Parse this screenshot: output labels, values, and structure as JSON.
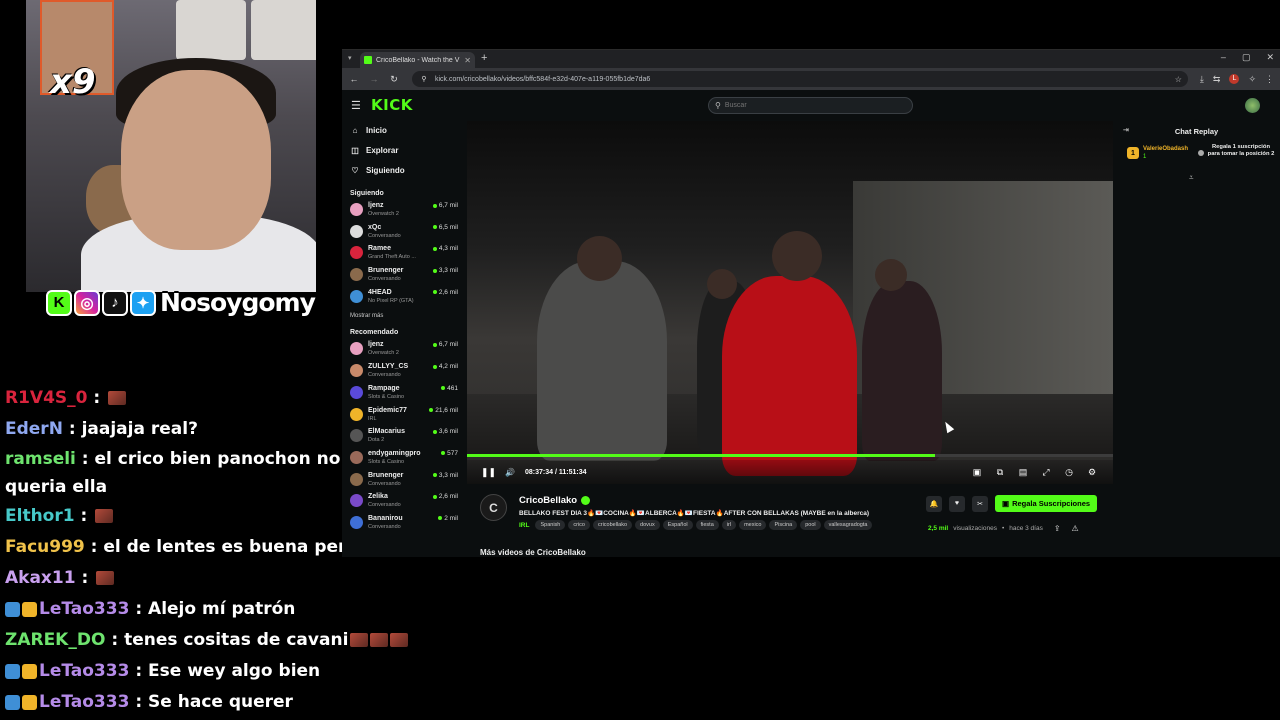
{
  "overlay": {
    "sub_count": "x9",
    "social_handle": "Nosoygomy",
    "social_icons": [
      "kick-icon",
      "instagram-icon",
      "tiktok-icon",
      "twitter-icon"
    ],
    "social_letters": {
      "kick": "K",
      "instagram": "◎",
      "tiktok": "♪",
      "twitter": "✦"
    },
    "chat": [
      {
        "user": "R1V4S_0",
        "color": "#d9243d",
        "sep": " : ",
        "text": "",
        "emotes": 1,
        "badges": []
      },
      {
        "user": "EderN",
        "color": "#8fa8f0",
        "sep": " : ",
        "text": "jaajaja real?",
        "emotes": 0,
        "badges": []
      },
      {
        "user": "ramseli",
        "color": "#6ee36e",
        "sep": " : ",
        "text": "el crico bien panochon no queria ella",
        "emotes": 0,
        "badges": [],
        "wrap": true
      },
      {
        "user": "Elthor1",
        "color": "#47c9c9",
        "sep": " : ",
        "text": "",
        "emotes": 1,
        "badges": []
      },
      {
        "user": "Facu999",
        "color": "#f0c24a",
        "sep": " : ",
        "text": "el de lentes es buena persona",
        "emotes": 0,
        "badges": []
      },
      {
        "user": "Akax11",
        "color": "#c9a0ef",
        "sep": " : ",
        "text": "",
        "emotes": 1,
        "badges": []
      },
      {
        "user": "LeTao333",
        "color": "#b58be8",
        "sep": " : ",
        "text": "Alejo mí patrón",
        "emotes": 0,
        "badges": [
          "cube",
          "crown"
        ]
      },
      {
        "user": "ZAREK_DO",
        "color": "#6ee36e",
        "sep": " : ",
        "text": "tenes cositas de cavani",
        "emotes": 3,
        "badges": []
      },
      {
        "user": "LeTao333",
        "color": "#b58be8",
        "sep": " : ",
        "text": "Ese wey algo bien",
        "emotes": 0,
        "badges": [
          "cube",
          "crown"
        ]
      },
      {
        "user": "LeTao333",
        "color": "#b58be8",
        "sep": " : ",
        "text": "Se hace querer",
        "emotes": 0,
        "badges": [
          "cube",
          "crown"
        ]
      }
    ]
  },
  "browser": {
    "tab_title": "CricoBellako - Watch the V",
    "url": "kick.com/cricobellako/videos/bffc584f-e32d-407e-a119-055fb1de7da6",
    "new_tab": "+",
    "window_controls": [
      "–",
      "▢",
      "✕"
    ]
  },
  "kick": {
    "logo": "KICK",
    "search_placeholder": "Buscar",
    "nav": [
      {
        "icon": "home-icon",
        "glyph": "⌂",
        "label": "Inicio"
      },
      {
        "icon": "compass-icon",
        "glyph": "◫",
        "label": "Explorar"
      },
      {
        "icon": "heart-icon",
        "glyph": "♡",
        "label": "Siguiendo"
      }
    ],
    "following_title": "Siguiendo",
    "following": [
      {
        "name": "ljenz",
        "game": "Overwatch 2",
        "viewers": "6,7 mil",
        "color": "#e8a0c0"
      },
      {
        "name": "xQc",
        "game": "Conversando",
        "viewers": "6,5 mil",
        "color": "#dddddd"
      },
      {
        "name": "Ramee",
        "game": "Grand Theft Auto ...",
        "viewers": "4,3 mil",
        "color": "#d9243d"
      },
      {
        "name": "Brunenger",
        "game": "Conversando",
        "viewers": "3,3 mil",
        "color": "#8a6a4c"
      },
      {
        "name": "4HEAD",
        "game": "No Pixel RP (GTA)",
        "viewers": "2,6 mil",
        "color": "#3f8fd6"
      }
    ],
    "show_more": "Mostrar más",
    "recommended_title": "Recomendado",
    "recommended": [
      {
        "name": "ljenz",
        "game": "Overwatch 2",
        "viewers": "6,7 mil",
        "color": "#e8a0c0"
      },
      {
        "name": "ZULLYY_CS",
        "game": "Conversando",
        "viewers": "4,2 mil",
        "color": "#c98a6a"
      },
      {
        "name": "Rampage",
        "game": "Slots & Casino",
        "viewers": "461",
        "color": "#5a4ad9"
      },
      {
        "name": "Epidemic77",
        "game": "IRL",
        "viewers": "21,6 mil",
        "color": "#f0b429"
      },
      {
        "name": "ElMacarius",
        "game": "Dota 2",
        "viewers": "3,6 mil",
        "color": "#555555"
      },
      {
        "name": "endygamingpro",
        "game": "Slots & Casino",
        "viewers": "577",
        "color": "#9a6a5a"
      },
      {
        "name": "Brunenger",
        "game": "Conversando",
        "viewers": "3,3 mil",
        "color": "#8a6a4c"
      },
      {
        "name": "Zelika",
        "game": "Conversando",
        "viewers": "2,6 mil",
        "color": "#7a4ac9"
      },
      {
        "name": "Bananirou",
        "game": "Conversando",
        "viewers": "2 mil",
        "color": "#3f6fd6"
      }
    ],
    "player": {
      "time": "08:37:34 / 11:51:34",
      "progress": 0.7246,
      "play_glyph": "❚❚",
      "volume_glyph": "🔊",
      "right_controls": [
        "▣",
        "⧉",
        "▤",
        "⤢",
        "◷",
        "⚙"
      ]
    },
    "video": {
      "channel": "CricoBellako",
      "avatar_letter": "C",
      "title": "BELLAKO FEST DIA 3🔥💌COCINA🔥💌ALBERCA🔥💌FIESTA🔥AFTER CON BELLAKAS (MAYBE en la alberca)",
      "category": "IRL",
      "tags": [
        "Spanish",
        "crico",
        "cricobellako",
        "dovux",
        "Español",
        "fiesta",
        "irl",
        "mexico",
        "Piscina",
        "pool",
        "vallesagradogta"
      ],
      "gift_label": "Regala Suscripciones",
      "views": "2,5 mil",
      "views_label": "visualizaciones",
      "when": "hace 3 días",
      "more_videos": "Más videos de CricoBellako"
    },
    "chat_replay": {
      "title": "Chat Replay",
      "pinned_user": "ValerieObadash",
      "pinned_badge": "1",
      "pinned_count": "1",
      "pinned_msg": "Regala 1 suscripción para tomar la posición 2"
    }
  },
  "colors": {
    "accent": "#53fc18",
    "background": "#0b0e0f"
  }
}
